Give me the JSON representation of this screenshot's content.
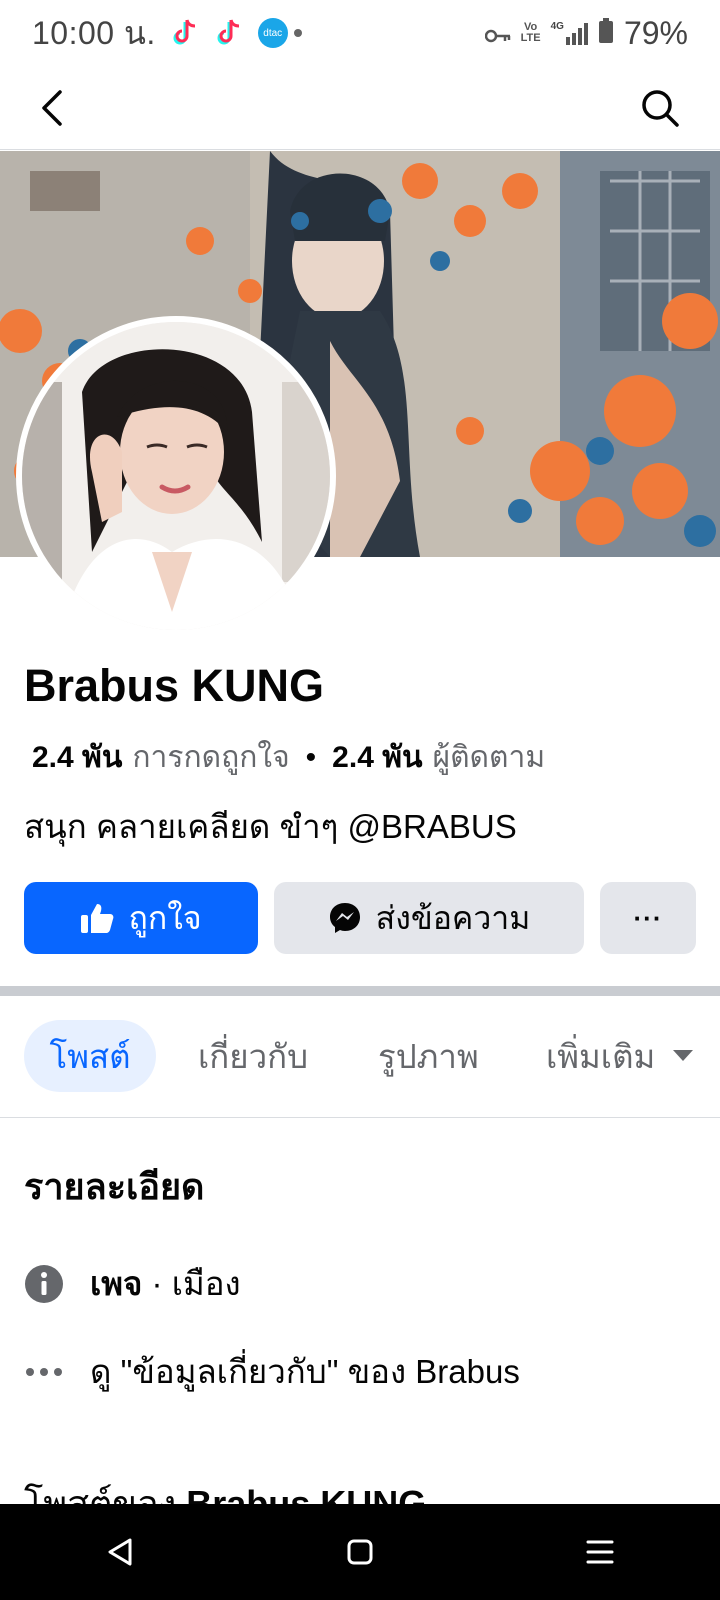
{
  "status_bar": {
    "time": "10:00 น.",
    "carrier_icon_label": "dtac",
    "volte_top": "Vo",
    "volte_bottom": "LTE",
    "network": "4G",
    "battery": "79%"
  },
  "profile": {
    "name": "Brabus KUNG",
    "likes_count": "2.4 พัน",
    "likes_label": "การกดถูกใจ",
    "separator": "•",
    "followers_count": "2.4 พัน",
    "followers_label": "ผู้ติดตาม",
    "bio": "สนุก คลายเคลียด ขำๆ @BRABUS"
  },
  "actions": {
    "like_label": "ถูกใจ",
    "message_label": "ส่งข้อความ",
    "more_label": "···"
  },
  "tabs": [
    {
      "label": "โพสต์"
    },
    {
      "label": "เกี่ยวกับ"
    },
    {
      "label": "รูปภาพ"
    },
    {
      "label": "เพิ่มเติม"
    }
  ],
  "details": {
    "title": "รายละเอียด",
    "page_type_bold": "เพจ",
    "page_type_rest": " · เมือง",
    "about_link": "ดู \"ข้อมูลเกี่ยวกับ\" ของ Brabus"
  },
  "posts": {
    "heading_prefix": "โพสต์ของ ",
    "heading_name": "Brabus KUNG"
  },
  "icons": {
    "back": "chevron-left-icon",
    "search": "search-icon",
    "like": "thumbs-up-icon",
    "messenger": "messenger-icon",
    "info": "info-icon",
    "dots": "more-dots-icon",
    "dropdown": "caret-down-icon"
  },
  "colors": {
    "primary": "#0866ff",
    "secondary_button": "#e4e6eb",
    "muted_text": "#65676b",
    "active_tab_bg": "#e7f0ff"
  }
}
